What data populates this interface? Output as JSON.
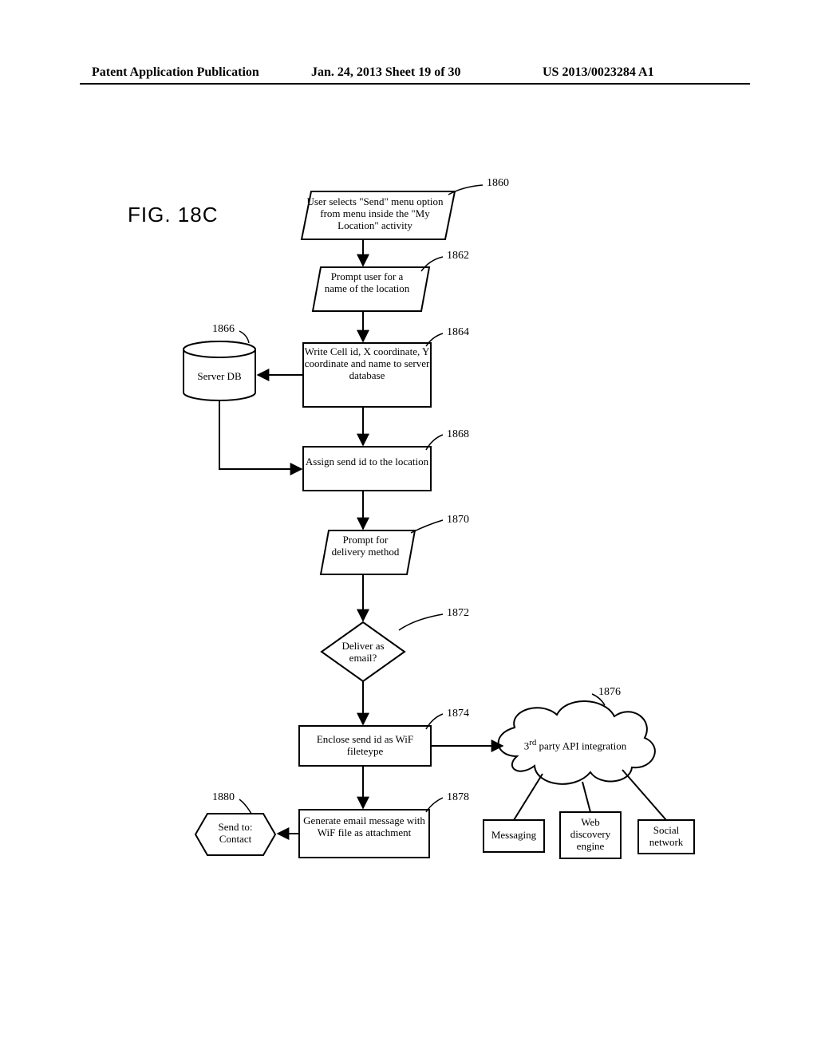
{
  "header": {
    "left": "Patent Application Publication",
    "mid": "Jan. 24, 2013  Sheet 19 of 30",
    "right": "US 2013/0023284 A1"
  },
  "figure_title": "FIG. 18C",
  "refs": {
    "r1860": "1860",
    "r1862": "1862",
    "r1864": "1864",
    "r1866": "1866",
    "r1868": "1868",
    "r1870": "1870",
    "r1872": "1872",
    "r1874": "1874",
    "r1876": "1876",
    "r1878": "1878",
    "r1880": "1880"
  },
  "db_label": "Server DB",
  "step1860": "User selects \"Send\" menu option from menu inside the \"My Location\" activity",
  "step1862": "Prompt user for a name of the location",
  "step1864": "Write Cell id, X coordinate, Y coordinate and name to server database",
  "step1868": "Assign send id to the location",
  "step1870": "Prompt for delivery method",
  "step1872": "Deliver as email?",
  "step1874": "Enclose send id as WiF fileteype",
  "step1876_line1": "3",
  "step1876_sup": "rd",
  "step1876_line2": " party API integration",
  "step1878": "Generate email message with WiF file as attachment",
  "step1880_line1": "Send to:",
  "step1880_line2": "Contact",
  "out_messaging": "Messaging",
  "out_web": "Web discovery engine",
  "out_social": "Social network"
}
